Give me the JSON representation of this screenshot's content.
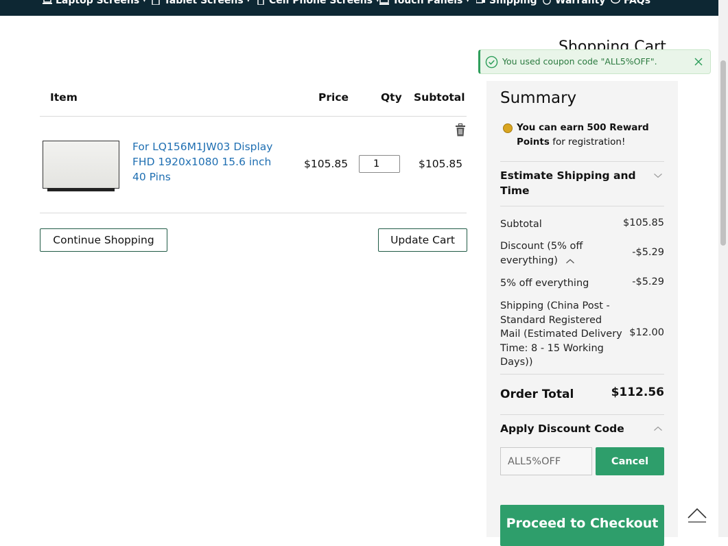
{
  "nav": {
    "items": [
      {
        "label": "Laptop Screens",
        "icon": "laptop-icon",
        "has_caret": true
      },
      {
        "label": "Tablet Screens",
        "icon": "tablet-icon",
        "has_caret": true
      },
      {
        "label": "Cell Phone Screens",
        "icon": "phone-icon",
        "has_caret": true
      },
      {
        "label": "Touch Panels",
        "icon": "touch-panel-icon",
        "has_caret": true
      },
      {
        "label": "Shipping",
        "icon": "truck-icon",
        "has_caret": false
      },
      {
        "label": "Warranty",
        "icon": "warranty-icon",
        "has_caret": false
      },
      {
        "label": "FAQs",
        "icon": "chat-icon",
        "has_caret": false
      }
    ]
  },
  "page": {
    "title": "Shopping Cart"
  },
  "toast": {
    "message": "You used coupon code \"ALL5%OFF\".",
    "color": "#2e9e5b"
  },
  "cart": {
    "headers": {
      "item": "Item",
      "price": "Price",
      "qty": "Qty",
      "subtotal": "Subtotal"
    },
    "items": [
      {
        "name": "For LQ156M1JW03 Display FHD 1920x1080 15.6 inch 40 Pins",
        "price": "$105.85",
        "qty": "1",
        "subtotal": "$105.85"
      }
    ],
    "continue_label": "Continue Shopping",
    "update_label": "Update Cart"
  },
  "summary": {
    "title": "Summary",
    "reward_prefix": "You can earn",
    "reward_bold": "500 Reward Points",
    "reward_suffix": "for registration!",
    "estimate_label": "Estimate Shipping and Time",
    "rows": {
      "subtotal_label": "Subtotal",
      "subtotal_value": "$105.85",
      "discount_label": "Discount (5% off everything)",
      "discount_value": "-$5.29",
      "discount_detail_label": "5% off everything",
      "discount_detail_value": "-$5.29",
      "shipping_label": "Shipping (China Post - Standard Registered Mail (Estimated Delivery Time: 8 - 15 Working Days))",
      "shipping_value": "$12.00"
    },
    "order_total_label": "Order Total",
    "order_total_value": "$112.56",
    "discount_code_label": "Apply Discount Code",
    "coupon_value": "ALL5%OFF",
    "cancel_label": "Cancel",
    "checkout_label": "Proceed to Checkout",
    "accent": "#2e9e6b"
  }
}
